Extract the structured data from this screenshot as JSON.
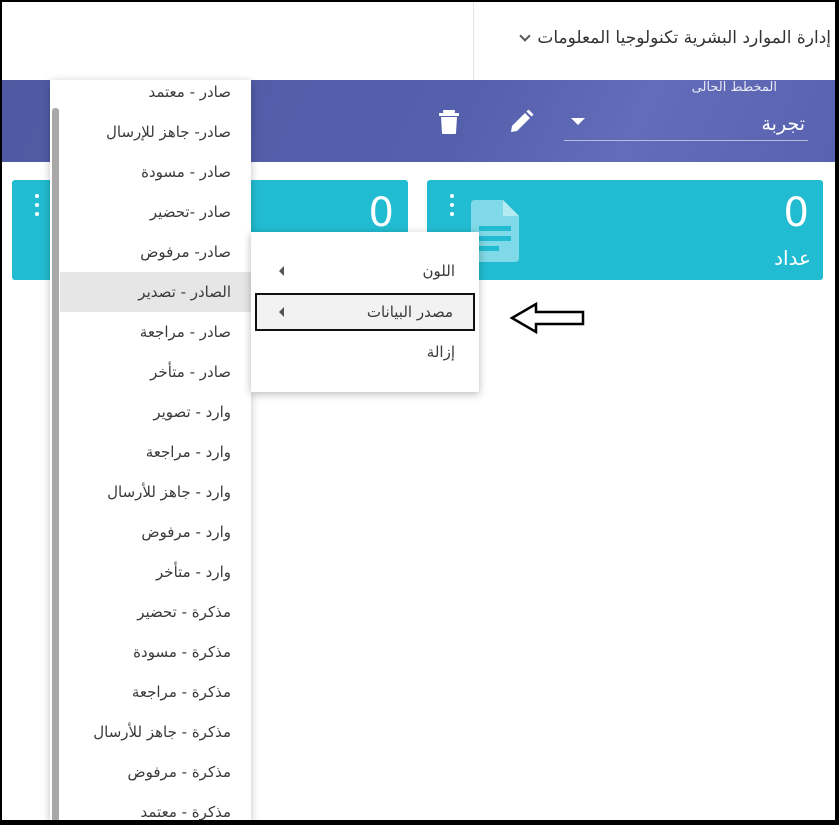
{
  "topbar": {
    "department": "إدارة الموارد البشرية تكنولوجيا المعلومات"
  },
  "plan": {
    "title": "المخطط الحالى",
    "value": "تجربة"
  },
  "cards": [
    {
      "value": "0",
      "label": "عداد"
    },
    {
      "value": "0",
      "label": ""
    }
  ],
  "list": {
    "items": [
      "صادر - معتمد",
      "صادر- جاهز للإرسال",
      "صادر - مسودة",
      "صادر -تحضير",
      "صادر- مرفوض",
      "الصادر - تصدير",
      "صادر - مراجعة",
      "صادر - متأخر",
      "وارد - تصوير",
      "وارد - مراجعة",
      "وارد - جاهز للأرسال",
      "وارد - مرفوض",
      "وارد - متأخر",
      "مذكرة - تحضير",
      "مذكرة - مسودة",
      "مذكرة - مراجعة",
      "مذكرة - جاهز للأرسال",
      "مذكرة - مرفوض",
      "مذكرة - معتمد"
    ],
    "active_index": 5
  },
  "context_menu": {
    "items": [
      {
        "label": "اللون",
        "has_submenu": true
      },
      {
        "label": "مصدر البيانات",
        "has_submenu": true
      },
      {
        "label": "إزالة",
        "has_submenu": false
      }
    ],
    "highlighted_index": 1
  },
  "colors": {
    "header": "#5560ad",
    "card": "#22bcd2",
    "card_icon": "#7fd9e6"
  },
  "icons": [
    "chevron-down-icon",
    "trash-icon",
    "pencil-icon",
    "caret-down-icon",
    "more-vert-icon",
    "document-icon",
    "arrow-left-icon"
  ]
}
